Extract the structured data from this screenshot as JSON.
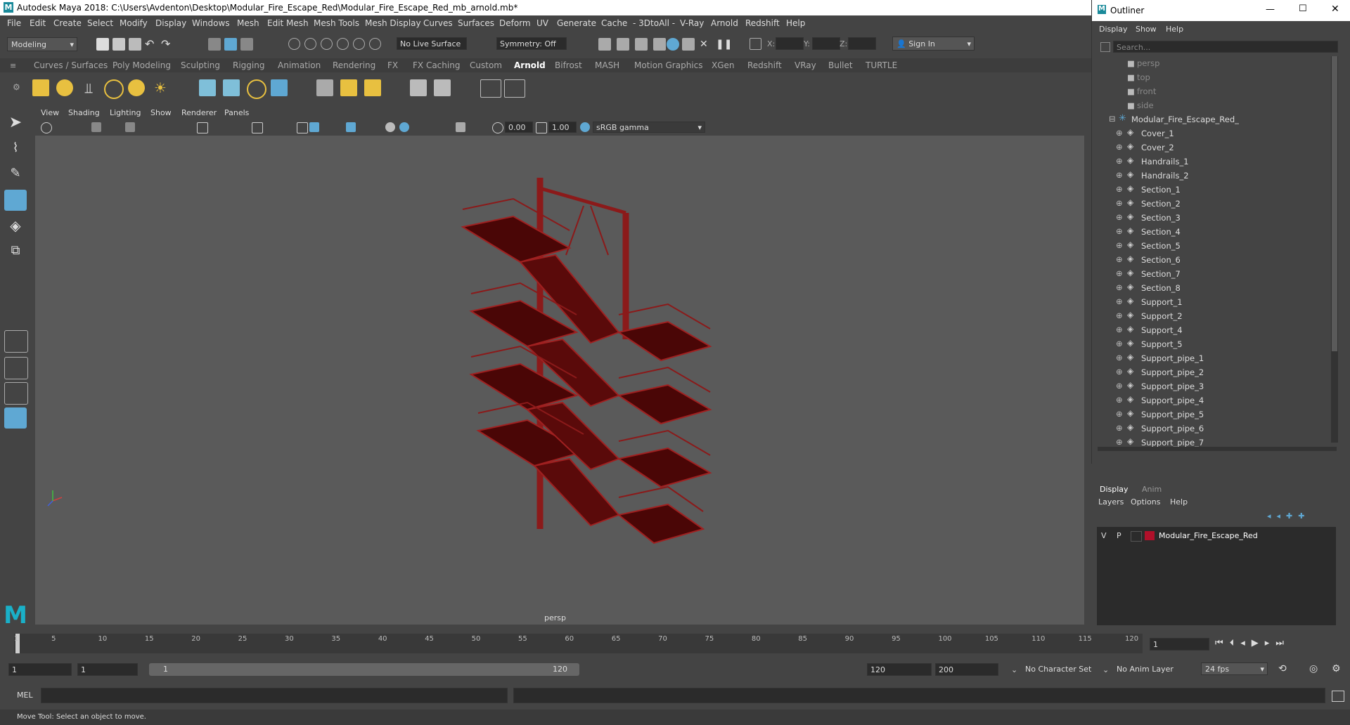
{
  "window": {
    "title": "Autodesk Maya 2018: C:\\Users\\Avdenton\\Desktop\\Modular_Fire_Escape_Red\\Modular_Fire_Escape_Red_mb_arnold.mb*"
  },
  "menubar": [
    "File",
    "Edit",
    "Create",
    "Select",
    "Modify",
    "Display",
    "Windows",
    "Mesh",
    "Edit Mesh",
    "Mesh Tools",
    "Mesh Display",
    "Curves",
    "Surfaces",
    "Deform",
    "UV",
    "Generate",
    "Cache",
    "- 3DtoAll -",
    "V-Ray",
    "Arnold",
    "Redshift",
    "Help"
  ],
  "statusline": {
    "mode": "Modeling",
    "live_surface": "No Live Surface",
    "symmetry": "Symmetry: Off",
    "x_label": "X:",
    "y_label": "Y:",
    "z_label": "Z:",
    "sign_in": "Sign In"
  },
  "shelf_tabs": [
    "Curves / Surfaces",
    "Poly Modeling",
    "Sculpting",
    "Rigging",
    "Animation",
    "Rendering",
    "FX",
    "FX Caching",
    "Custom",
    "Arnold",
    "Bifrost",
    "MASH",
    "Motion Graphics",
    "XGen",
    "Redshift",
    "VRay",
    "Bullet",
    "TURTLE"
  ],
  "active_shelf": "Arnold",
  "viewport": {
    "menus": [
      "View",
      "Shading",
      "Lighting",
      "Show",
      "Renderer",
      "Panels"
    ],
    "exposure": "0.00",
    "gamma": "1.00",
    "color_space": "sRGB gamma",
    "camera_label": "persp"
  },
  "outliner": {
    "title": "Outliner",
    "menus": [
      "Display",
      "Show",
      "Help"
    ],
    "search_placeholder": "Search...",
    "cameras": [
      "persp",
      "top",
      "front",
      "side"
    ],
    "group": "Modular_Fire_Escape_Red_",
    "children": [
      "Cover_1",
      "Cover_2",
      "Handrails_1",
      "Handrails_2",
      "Section_1",
      "Section_2",
      "Section_3",
      "Section_4",
      "Section_5",
      "Section_6",
      "Section_7",
      "Section_8",
      "Support_1",
      "Support_2",
      "Support_4",
      "Support_5",
      "Support_pipe_1",
      "Support_pipe_2",
      "Support_pipe_3",
      "Support_pipe_4",
      "Support_pipe_5",
      "Support_pipe_6",
      "Support_pipe_7"
    ]
  },
  "layer_editor": {
    "tabs": [
      "Display",
      "Anim"
    ],
    "menus": [
      "Layers",
      "Options",
      "Help"
    ],
    "layer": {
      "v": "V",
      "p": "P",
      "name": "Modular_Fire_Escape_Red",
      "color": "#b0102a"
    }
  },
  "timeline": {
    "ticks": [
      "1",
      "5",
      "10",
      "15",
      "20",
      "25",
      "30",
      "35",
      "40",
      "45",
      "50",
      "55",
      "60",
      "65",
      "70",
      "75",
      "80",
      "85",
      "90",
      "95",
      "100",
      "105",
      "110",
      "115",
      "120"
    ],
    "current_frame": "1"
  },
  "range": {
    "start": "1",
    "anim_start": "1",
    "range_start": "1",
    "range_end": "120",
    "end": "120",
    "anim_end": "200",
    "character_set": "No Character Set",
    "anim_layer": "No Anim Layer",
    "fps": "24 fps"
  },
  "cmdline": {
    "label": "MEL"
  },
  "helpline": {
    "text": "Move Tool: Select an object to move."
  },
  "colors": {
    "model": "#8b1a1a",
    "accent": "#5fa8d3"
  }
}
